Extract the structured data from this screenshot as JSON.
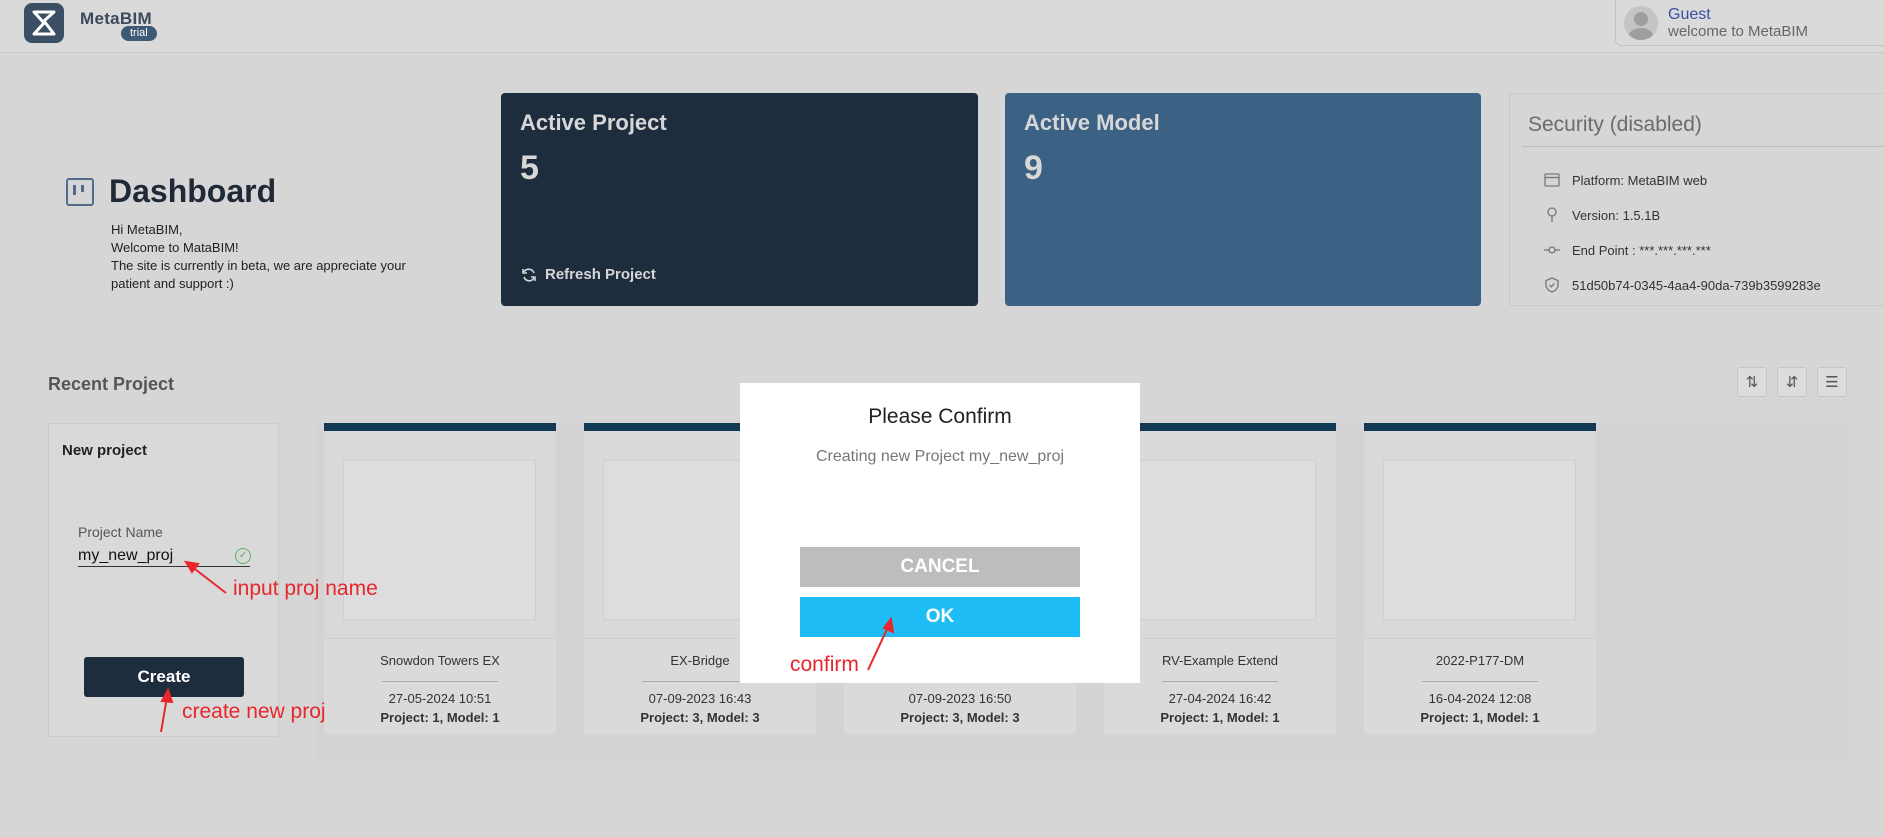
{
  "header": {
    "app_name": "MetaBIM",
    "badge": "trial",
    "user_name": "Guest",
    "user_subtitle": "welcome to MetaBIM"
  },
  "dashboard": {
    "title": "Dashboard",
    "greeting": "Hi MetaBIM,",
    "welcome": "Welcome to MataBIM!",
    "message": "The site is currently in beta, we are appreciate your patient and support :)"
  },
  "cards": {
    "active_project": {
      "label": "Active Project",
      "value": "5",
      "action": "Refresh Project"
    },
    "active_model": {
      "label": "Active Model",
      "value": "9"
    }
  },
  "security": {
    "title": "Security (disabled)",
    "platform": "Platform: MetaBIM web",
    "version": "Version: 1.5.1B",
    "endpoint": "End Point : ***.***.***.***",
    "id": "51d50b74-0345-4aa4-90da-739b3599283e"
  },
  "recent": {
    "title": "Recent Project",
    "new_project": {
      "title": "New project",
      "field_label": "Project Name",
      "field_value": "my_new_proj",
      "button": "Create"
    },
    "projects": [
      {
        "name": "Snowdon Towers EX",
        "date": "27-05-2024 10:51",
        "meta": "Project: 1, Model: 1"
      },
      {
        "name": "EX-Bridge",
        "date": "07-09-2023 16:43",
        "meta": "Project: 3, Model: 3"
      },
      {
        "name": "",
        "date": "07-09-2023 16:50",
        "meta": "Project: 3, Model: 3"
      },
      {
        "name": "RV-Example Extend",
        "date": "27-04-2024 16:42",
        "meta": "Project: 1, Model: 1"
      },
      {
        "name": "2022-P177-DM",
        "date": "16-04-2024 12:08",
        "meta": "Project: 1, Model: 1"
      }
    ]
  },
  "modal": {
    "title": "Please Confirm",
    "message": "Creating new Project my_new_proj",
    "cancel": "CANCEL",
    "ok": "OK"
  },
  "annotations": {
    "input_note": "input proj name",
    "create_note": "create new proj",
    "confirm_note": "confirm"
  },
  "colors": {
    "active_project_bg": "#1e2d3e",
    "active_model_bg": "#3b6184",
    "ok_button": "#1fbdf5",
    "annotation": "#e8262b"
  }
}
